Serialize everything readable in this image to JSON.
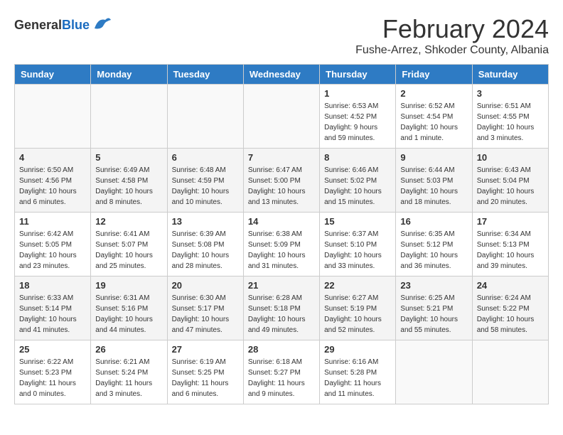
{
  "header": {
    "logo_general": "General",
    "logo_blue": "Blue",
    "month": "February 2024",
    "location": "Fushe-Arrez, Shkoder County, Albania"
  },
  "weekdays": [
    "Sunday",
    "Monday",
    "Tuesday",
    "Wednesday",
    "Thursday",
    "Friday",
    "Saturday"
  ],
  "weeks": [
    [
      {
        "day": "",
        "info": ""
      },
      {
        "day": "",
        "info": ""
      },
      {
        "day": "",
        "info": ""
      },
      {
        "day": "",
        "info": ""
      },
      {
        "day": "1",
        "info": "Sunrise: 6:53 AM\nSunset: 4:52 PM\nDaylight: 9 hours and 59 minutes."
      },
      {
        "day": "2",
        "info": "Sunrise: 6:52 AM\nSunset: 4:54 PM\nDaylight: 10 hours and 1 minute."
      },
      {
        "day": "3",
        "info": "Sunrise: 6:51 AM\nSunset: 4:55 PM\nDaylight: 10 hours and 3 minutes."
      }
    ],
    [
      {
        "day": "4",
        "info": "Sunrise: 6:50 AM\nSunset: 4:56 PM\nDaylight: 10 hours and 6 minutes."
      },
      {
        "day": "5",
        "info": "Sunrise: 6:49 AM\nSunset: 4:58 PM\nDaylight: 10 hours and 8 minutes."
      },
      {
        "day": "6",
        "info": "Sunrise: 6:48 AM\nSunset: 4:59 PM\nDaylight: 10 hours and 10 minutes."
      },
      {
        "day": "7",
        "info": "Sunrise: 6:47 AM\nSunset: 5:00 PM\nDaylight: 10 hours and 13 minutes."
      },
      {
        "day": "8",
        "info": "Sunrise: 6:46 AM\nSunset: 5:02 PM\nDaylight: 10 hours and 15 minutes."
      },
      {
        "day": "9",
        "info": "Sunrise: 6:44 AM\nSunset: 5:03 PM\nDaylight: 10 hours and 18 minutes."
      },
      {
        "day": "10",
        "info": "Sunrise: 6:43 AM\nSunset: 5:04 PM\nDaylight: 10 hours and 20 minutes."
      }
    ],
    [
      {
        "day": "11",
        "info": "Sunrise: 6:42 AM\nSunset: 5:05 PM\nDaylight: 10 hours and 23 minutes."
      },
      {
        "day": "12",
        "info": "Sunrise: 6:41 AM\nSunset: 5:07 PM\nDaylight: 10 hours and 25 minutes."
      },
      {
        "day": "13",
        "info": "Sunrise: 6:39 AM\nSunset: 5:08 PM\nDaylight: 10 hours and 28 minutes."
      },
      {
        "day": "14",
        "info": "Sunrise: 6:38 AM\nSunset: 5:09 PM\nDaylight: 10 hours and 31 minutes."
      },
      {
        "day": "15",
        "info": "Sunrise: 6:37 AM\nSunset: 5:10 PM\nDaylight: 10 hours and 33 minutes."
      },
      {
        "day": "16",
        "info": "Sunrise: 6:35 AM\nSunset: 5:12 PM\nDaylight: 10 hours and 36 minutes."
      },
      {
        "day": "17",
        "info": "Sunrise: 6:34 AM\nSunset: 5:13 PM\nDaylight: 10 hours and 39 minutes."
      }
    ],
    [
      {
        "day": "18",
        "info": "Sunrise: 6:33 AM\nSunset: 5:14 PM\nDaylight: 10 hours and 41 minutes."
      },
      {
        "day": "19",
        "info": "Sunrise: 6:31 AM\nSunset: 5:16 PM\nDaylight: 10 hours and 44 minutes."
      },
      {
        "day": "20",
        "info": "Sunrise: 6:30 AM\nSunset: 5:17 PM\nDaylight: 10 hours and 47 minutes."
      },
      {
        "day": "21",
        "info": "Sunrise: 6:28 AM\nSunset: 5:18 PM\nDaylight: 10 hours and 49 minutes."
      },
      {
        "day": "22",
        "info": "Sunrise: 6:27 AM\nSunset: 5:19 PM\nDaylight: 10 hours and 52 minutes."
      },
      {
        "day": "23",
        "info": "Sunrise: 6:25 AM\nSunset: 5:21 PM\nDaylight: 10 hours and 55 minutes."
      },
      {
        "day": "24",
        "info": "Sunrise: 6:24 AM\nSunset: 5:22 PM\nDaylight: 10 hours and 58 minutes."
      }
    ],
    [
      {
        "day": "25",
        "info": "Sunrise: 6:22 AM\nSunset: 5:23 PM\nDaylight: 11 hours and 0 minutes."
      },
      {
        "day": "26",
        "info": "Sunrise: 6:21 AM\nSunset: 5:24 PM\nDaylight: 11 hours and 3 minutes."
      },
      {
        "day": "27",
        "info": "Sunrise: 6:19 AM\nSunset: 5:25 PM\nDaylight: 11 hours and 6 minutes."
      },
      {
        "day": "28",
        "info": "Sunrise: 6:18 AM\nSunset: 5:27 PM\nDaylight: 11 hours and 9 minutes."
      },
      {
        "day": "29",
        "info": "Sunrise: 6:16 AM\nSunset: 5:28 PM\nDaylight: 11 hours and 11 minutes."
      },
      {
        "day": "",
        "info": ""
      },
      {
        "day": "",
        "info": ""
      }
    ]
  ]
}
